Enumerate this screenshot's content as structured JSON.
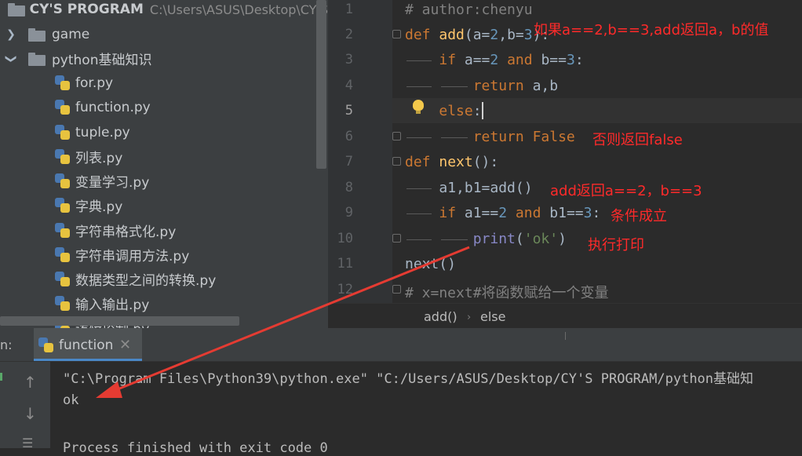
{
  "project": {
    "title": "CY'S PROGRAM",
    "path": "C:\\Users\\ASUS\\Desktop\\CY'S",
    "tree": [
      {
        "label": "game",
        "type": "folder",
        "expanded": false
      },
      {
        "label": "python基础知识",
        "type": "folder",
        "expanded": true
      },
      {
        "label": "for.py",
        "type": "file"
      },
      {
        "label": "function.py",
        "type": "file"
      },
      {
        "label": "tuple.py",
        "type": "file"
      },
      {
        "label": "列表.py",
        "type": "file"
      },
      {
        "label": "变量学习.py",
        "type": "file"
      },
      {
        "label": "字典.py",
        "type": "file"
      },
      {
        "label": "字符串格式化.py",
        "type": "file"
      },
      {
        "label": "字符串调用方法.py",
        "type": "file"
      },
      {
        "label": "数据类型之间的转换.py",
        "type": "file"
      },
      {
        "label": "输入输出.py",
        "type": "file"
      },
      {
        "label": "逻辑控制.py",
        "type": "file"
      }
    ]
  },
  "editor": {
    "line_numbers": [
      "1",
      "2",
      "3",
      "4",
      "5",
      "6",
      "7",
      "8",
      "9",
      "10",
      "11",
      "12"
    ],
    "current_line": 5,
    "code": {
      "l1": "# author:chenyu",
      "l2_def": "def",
      "l2_name": "add",
      "l2_params": "(a=",
      "l2_n1": "2",
      "l2_mid": ",b=",
      "l2_n2": "3",
      "l2_end": "):",
      "l3_if": "if",
      "l3_a": " a==",
      "l3_n1": "2",
      "l3_and": " and",
      "l3_b": " b==",
      "l3_n2": "3",
      "l3_end": ":",
      "l4_return": "return",
      "l4_rest": " a,b",
      "l5_else": "else",
      "l5_colon": ":",
      "l6_return": "return",
      "l6_false": " False",
      "l7_def": "def",
      "l7_name": "next",
      "l7_end": "():",
      "l8": "a1,b1=add()",
      "l9_if": "if",
      "l9_a": " a1==",
      "l9_n1": "2",
      "l9_and": " and",
      "l9_b": " b1==",
      "l9_n2": "3",
      "l9_end": ":",
      "l10_print": "print",
      "l10_open": "(",
      "l10_str": "'ok'",
      "l10_close": ")",
      "l11": "next()",
      "l12": "# x=next#将函数赋给一个变量"
    },
    "annotations": {
      "a1": "如果a==2,b==3,add返回a，b的值",
      "a2": "否则返回false",
      "a3": "add返回a==2，b==3",
      "a4": "条件成立",
      "a5": "执行打印"
    },
    "breadcrumb": [
      "add()",
      "else"
    ]
  },
  "run": {
    "label": "n:",
    "tab": "function",
    "console": [
      "\"C:\\Program Files\\Python39\\python.exe\" \"C:/Users/ASUS/Desktop/CY'S PROGRAM/python基础知",
      "ok",
      "Process finished with exit code 0"
    ]
  },
  "colors": {
    "annotation": "#ff2a2a",
    "arrow": "#e53b32",
    "keyword": "#cc7832",
    "function_name": "#ffc66d",
    "number": "#6897bb",
    "string": "#6a8759",
    "comment": "#808080"
  }
}
